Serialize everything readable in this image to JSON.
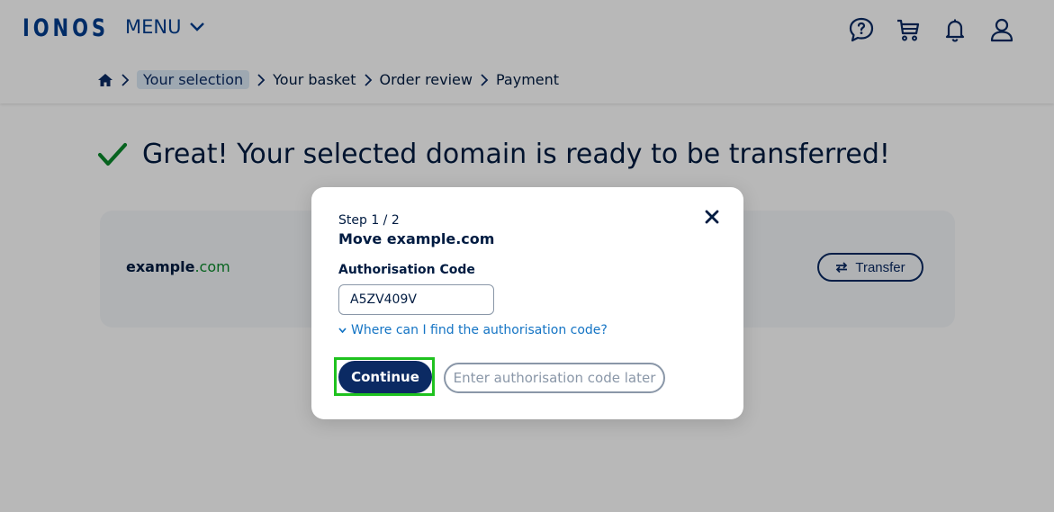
{
  "header": {
    "logo": "IONOS",
    "menu_label": "MENU",
    "icons": [
      "help-chat-icon",
      "cart-icon",
      "bell-icon",
      "user-icon"
    ]
  },
  "breadcrumb": {
    "items": [
      "Your selection",
      "Your basket",
      "Order review",
      "Payment"
    ],
    "active_index": 0
  },
  "main": {
    "headline": "Great! Your selected domain is ready to be transferred!",
    "domain": {
      "name": "example",
      "tld": ".com"
    },
    "transfer_label": "Transfer"
  },
  "modal": {
    "step": "Step 1 / 2",
    "title": "Move example.com",
    "auth_label": "Authorisation Code",
    "auth_value": "A5ZV409V",
    "help_link": "Where can I find the authorisation code?",
    "continue_label": "Continue",
    "later_label": "Enter authorisation code later"
  },
  "colors": {
    "brand": "#003d8f",
    "primary_button": "#0b2a63",
    "link": "#1474c4",
    "success": "#0b8a2b",
    "highlight": "#1fc21f"
  }
}
